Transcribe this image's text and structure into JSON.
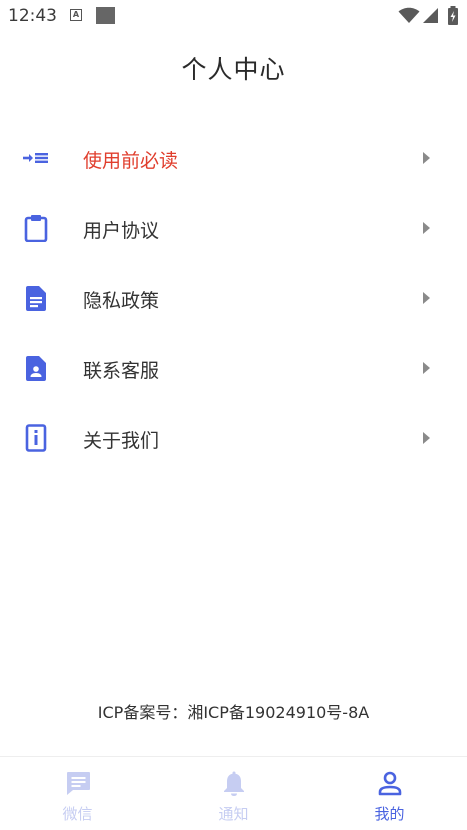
{
  "status_bar": {
    "time": "12:43",
    "indicator_letter": "A"
  },
  "header": {
    "title": "个人中心"
  },
  "colors": {
    "primary": "#4a63e0",
    "accent": "#e03e2d",
    "inactive_nav": "#c6cdf2"
  },
  "menu": {
    "items": [
      {
        "label": "使用前必读",
        "icon": "indent-list-icon",
        "highlighted": true
      },
      {
        "label": "用户协议",
        "icon": "clipboard-icon"
      },
      {
        "label": "隐私政策",
        "icon": "document-icon"
      },
      {
        "label": "联系客服",
        "icon": "contact-document-icon"
      },
      {
        "label": "关于我们",
        "icon": "info-icon"
      }
    ]
  },
  "footer": {
    "icp": "ICP备案号：湘ICP备19024910号-8A"
  },
  "bottom_nav": {
    "items": [
      {
        "label": "微信",
        "icon": "chat-bubble-icon",
        "active": false
      },
      {
        "label": "通知",
        "icon": "bell-icon",
        "active": false
      },
      {
        "label": "我的",
        "icon": "person-icon",
        "active": true
      }
    ]
  }
}
